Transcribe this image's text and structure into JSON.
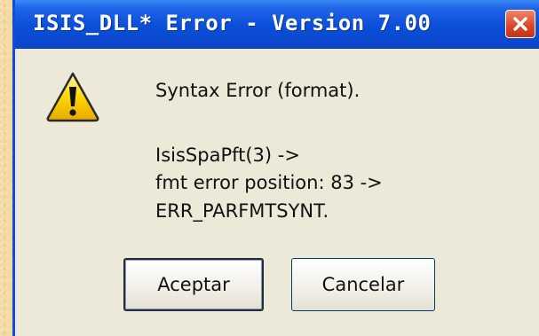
{
  "window": {
    "title": "ISIS_DLL* Error - Version 7.00",
    "close_icon": "close-icon"
  },
  "message": {
    "icon": "warning-icon",
    "headline": "Syntax Error (format).",
    "lines": [
      "IsisSpaPft(3) ->",
      "fmt error position: 83 ->",
      "ERR_PARFMTSYNT."
    ]
  },
  "buttons": {
    "ok_label": "Aceptar",
    "cancel_label": "Cancelar"
  },
  "colors": {
    "titlebar": "#0b4fd8",
    "dialog_bg": "#ece9d8",
    "close_button": "#d9442a",
    "background": "#f4d9a3"
  }
}
